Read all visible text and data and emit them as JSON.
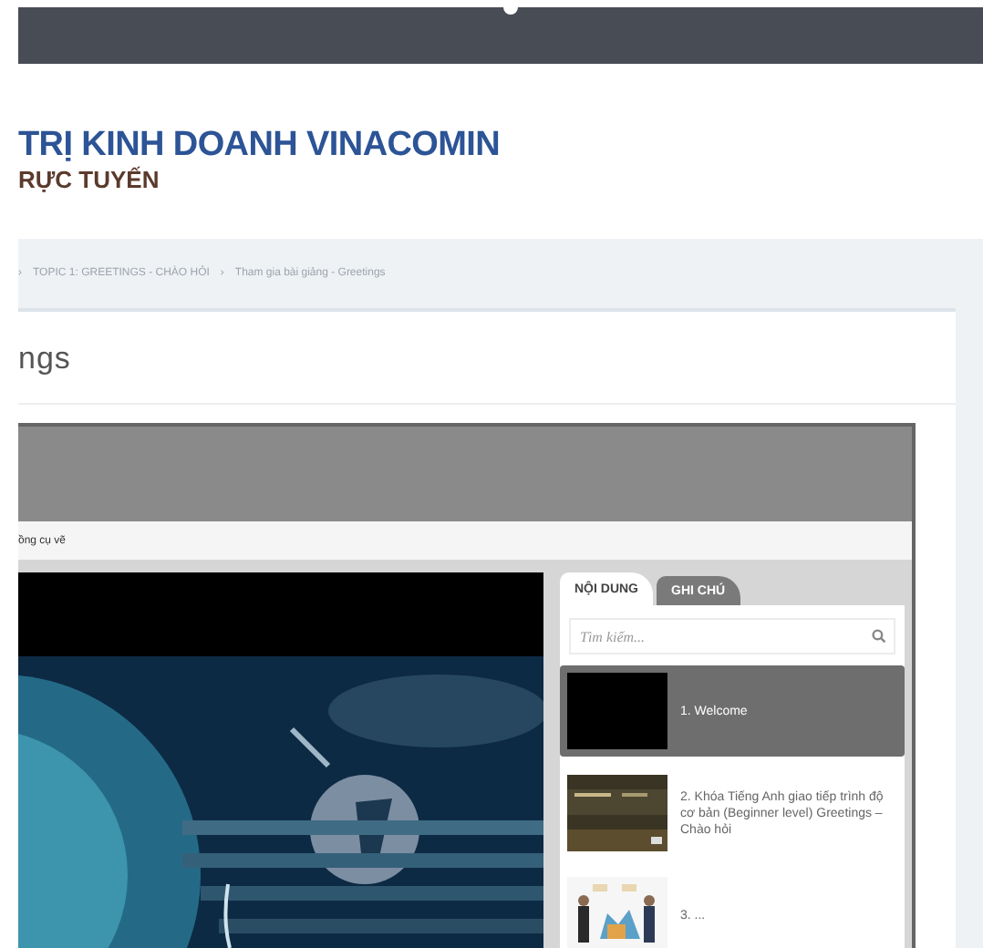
{
  "header": {
    "title_line1": "TRỊ KINH DOANH VINACOMIN",
    "title_line2": "RỰC TUYẾN"
  },
  "breadcrumb": {
    "separator": "›",
    "items": [
      "TOPIC 1: GREETINGS - CHÀO HỎI",
      "Tham gia bài giảng - Greetings"
    ]
  },
  "page_title": "ngs",
  "player": {
    "toolbar_label": "ồng cụ vẽ",
    "tabs": [
      {
        "label": "NỘI DUNG",
        "selected": true
      },
      {
        "label": "GHI CHÚ",
        "selected": false
      }
    ],
    "search": {
      "placeholder": "Tìm kiếm..."
    },
    "lessons": [
      {
        "title": "1. Welcome",
        "selected": true,
        "kind": "black"
      },
      {
        "title": "2. Khóa Tiếng Anh giao tiếp trình độ cơ bản (Beginner level) Greetings – Chào hỏi",
        "selected": false,
        "kind": "picture"
      },
      {
        "title": "3. ...",
        "selected": false,
        "kind": "figures"
      }
    ]
  }
}
